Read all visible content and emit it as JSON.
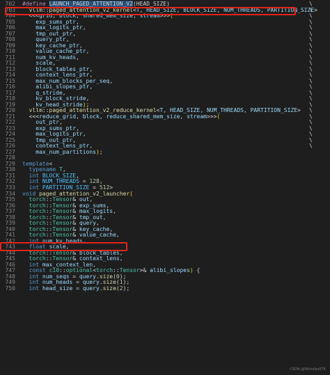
{
  "colors": {
    "background": "#1e1e1e",
    "line_number": "#858585",
    "highlight_box": "#e2251c",
    "selection": "#264f78"
  },
  "watermark": "CSDN @Nicholas07K",
  "continuation_char": "\\",
  "lines": [
    {
      "n": "702",
      "cont": true,
      "tokens": [
        [
          "macro",
          "#define "
        ],
        [
          "hl",
          "LAUNCH_PAGED_ATTENTION_V2"
        ],
        [
          "punc",
          "(HEAD_SIZE)"
        ]
      ]
    },
    {
      "n": "703",
      "cont": true,
      "tokens": [
        [
          "punc",
          "  "
        ],
        [
          "func",
          "vllm"
        ],
        [
          "punc",
          "::"
        ],
        [
          "func",
          "paged_attention_v2_kernel"
        ],
        [
          "punc",
          "<"
        ],
        [
          "var",
          "T"
        ],
        [
          "punc",
          ", "
        ],
        [
          "var",
          "HEAD_SIZE"
        ],
        [
          "punc",
          ", "
        ],
        [
          "var",
          "BLOCK_SIZE"
        ],
        [
          "punc",
          ", "
        ],
        [
          "var",
          "NUM_THREADS"
        ],
        [
          "punc",
          ", "
        ],
        [
          "var",
          "PARTITION_SIZE"
        ],
        [
          "punc",
          ">"
        ]
      ]
    },
    {
      "n": "704",
      "cont": true,
      "tokens": [
        [
          "punc",
          "  <<<"
        ],
        [
          "var",
          "grid"
        ],
        [
          "punc",
          ", "
        ],
        [
          "var",
          "block"
        ],
        [
          "punc",
          ", "
        ],
        [
          "var",
          "shared_mem_size"
        ],
        [
          "punc",
          ", "
        ],
        [
          "var",
          "stream"
        ],
        [
          "punc",
          ">>>"
        ],
        [
          "brace",
          "("
        ]
      ]
    },
    {
      "n": "705",
      "cont": true,
      "tokens": [
        [
          "punc",
          "    "
        ],
        [
          "var",
          "exp_sums_ptr"
        ],
        [
          "punc",
          ","
        ]
      ]
    },
    {
      "n": "706",
      "cont": true,
      "tokens": [
        [
          "punc",
          "    "
        ],
        [
          "var",
          "max_logits_ptr"
        ],
        [
          "punc",
          ","
        ]
      ]
    },
    {
      "n": "707",
      "cont": true,
      "tokens": [
        [
          "punc",
          "    "
        ],
        [
          "var",
          "tmp_out_ptr"
        ],
        [
          "punc",
          ","
        ]
      ]
    },
    {
      "n": "708",
      "cont": true,
      "tokens": [
        [
          "punc",
          "    "
        ],
        [
          "var",
          "query_ptr"
        ],
        [
          "punc",
          ","
        ]
      ]
    },
    {
      "n": "709",
      "cont": true,
      "tokens": [
        [
          "punc",
          "    "
        ],
        [
          "var",
          "key_cache_ptr"
        ],
        [
          "punc",
          ","
        ]
      ]
    },
    {
      "n": "710",
      "cont": true,
      "tokens": [
        [
          "punc",
          "    "
        ],
        [
          "var",
          "value_cache_ptr"
        ],
        [
          "punc",
          ","
        ]
      ]
    },
    {
      "n": "711",
      "cont": true,
      "tokens": [
        [
          "punc",
          "    "
        ],
        [
          "var",
          "num_kv_heads"
        ],
        [
          "punc",
          ","
        ]
      ]
    },
    {
      "n": "712",
      "cont": true,
      "tokens": [
        [
          "punc",
          "    "
        ],
        [
          "var",
          "scale"
        ],
        [
          "punc",
          ","
        ]
      ]
    },
    {
      "n": "713",
      "cont": true,
      "tokens": [
        [
          "punc",
          "    "
        ],
        [
          "var",
          "block_tables_ptr"
        ],
        [
          "punc",
          ","
        ]
      ]
    },
    {
      "n": "714",
      "cont": true,
      "tokens": [
        [
          "punc",
          "    "
        ],
        [
          "var",
          "context_lens_ptr"
        ],
        [
          "punc",
          ","
        ]
      ]
    },
    {
      "n": "715",
      "cont": true,
      "tokens": [
        [
          "punc",
          "    "
        ],
        [
          "var",
          "max_num_blocks_per_seq"
        ],
        [
          "punc",
          ","
        ]
      ]
    },
    {
      "n": "716",
      "cont": true,
      "tokens": [
        [
          "punc",
          "    "
        ],
        [
          "var",
          "alibi_slopes_ptr"
        ],
        [
          "punc",
          ","
        ]
      ]
    },
    {
      "n": "717",
      "cont": true,
      "tokens": [
        [
          "punc",
          "    "
        ],
        [
          "var",
          "q_stride"
        ],
        [
          "punc",
          ","
        ]
      ]
    },
    {
      "n": "718",
      "cont": true,
      "tokens": [
        [
          "punc",
          "    "
        ],
        [
          "var",
          "kv_block_stride"
        ],
        [
          "punc",
          ","
        ]
      ]
    },
    {
      "n": "719",
      "cont": true,
      "tokens": [
        [
          "punc",
          "    "
        ],
        [
          "var",
          "kv_head_stride"
        ],
        [
          "brace",
          ")"
        ],
        [
          "punc",
          ";"
        ]
      ]
    },
    {
      "n": "720",
      "cont": true,
      "tokens": [
        [
          "punc",
          "  "
        ],
        [
          "func",
          "vllm"
        ],
        [
          "punc",
          "::"
        ],
        [
          "func",
          "paged_attention_v2_reduce_kernel"
        ],
        [
          "punc",
          "<"
        ],
        [
          "var",
          "T"
        ],
        [
          "punc",
          ", "
        ],
        [
          "var",
          "HEAD_SIZE"
        ],
        [
          "punc",
          ", "
        ],
        [
          "var",
          "NUM_THREADS"
        ],
        [
          "punc",
          ", "
        ],
        [
          "var",
          "PARTITION_SIZE"
        ],
        [
          "punc",
          ">"
        ]
      ]
    },
    {
      "n": "721",
      "cont": true,
      "tokens": [
        [
          "punc",
          "  <<<"
        ],
        [
          "var",
          "reduce_grid"
        ],
        [
          "punc",
          ", "
        ],
        [
          "var",
          "block"
        ],
        [
          "punc",
          ", "
        ],
        [
          "var",
          "reduce_shared_mem_size"
        ],
        [
          "punc",
          ", "
        ],
        [
          "var",
          "stream"
        ],
        [
          "punc",
          ">>>"
        ],
        [
          "brace",
          "("
        ]
      ]
    },
    {
      "n": "722",
      "cont": true,
      "tokens": [
        [
          "punc",
          "    "
        ],
        [
          "var",
          "out_ptr"
        ],
        [
          "punc",
          ","
        ]
      ]
    },
    {
      "n": "723",
      "cont": true,
      "tokens": [
        [
          "punc",
          "    "
        ],
        [
          "var",
          "exp_sums_ptr"
        ],
        [
          "punc",
          ","
        ]
      ]
    },
    {
      "n": "724",
      "cont": true,
      "tokens": [
        [
          "punc",
          "    "
        ],
        [
          "var",
          "max_logits_ptr"
        ],
        [
          "punc",
          ","
        ]
      ]
    },
    {
      "n": "725",
      "cont": true,
      "tokens": [
        [
          "punc",
          "    "
        ],
        [
          "var",
          "tmp_out_ptr"
        ],
        [
          "punc",
          ","
        ]
      ]
    },
    {
      "n": "726",
      "cont": true,
      "tokens": [
        [
          "punc",
          "    "
        ],
        [
          "var",
          "context_lens_ptr"
        ],
        [
          "punc",
          ","
        ]
      ]
    },
    {
      "n": "727",
      "cont": false,
      "tokens": [
        [
          "punc",
          "    "
        ],
        [
          "var",
          "max_num_partitions"
        ],
        [
          "brace",
          ")"
        ],
        [
          "punc",
          ";"
        ]
      ]
    },
    {
      "n": "728",
      "cont": false,
      "tokens": []
    },
    {
      "n": "729",
      "cont": false,
      "tokens": [
        [
          "kw",
          "template"
        ],
        [
          "punc",
          "<"
        ]
      ]
    },
    {
      "n": "730",
      "cont": false,
      "tokens": [
        [
          "punc",
          "  "
        ],
        [
          "kw",
          "typename"
        ],
        [
          "punc",
          " "
        ],
        [
          "type",
          "T"
        ],
        [
          "punc",
          ","
        ]
      ]
    },
    {
      "n": "731",
      "cont": false,
      "tokens": [
        [
          "punc",
          "  "
        ],
        [
          "kw",
          "int"
        ],
        [
          "punc",
          " "
        ],
        [
          "const",
          "BLOCK_SIZE"
        ],
        [
          "punc",
          ","
        ]
      ]
    },
    {
      "n": "732",
      "cont": false,
      "tokens": [
        [
          "punc",
          "  "
        ],
        [
          "kw",
          "int"
        ],
        [
          "punc",
          " "
        ],
        [
          "const",
          "NUM_THREADS"
        ],
        [
          "punc",
          " = "
        ],
        [
          "num",
          "128"
        ],
        [
          "punc",
          ","
        ]
      ]
    },
    {
      "n": "733",
      "cont": false,
      "tokens": [
        [
          "punc",
          "  "
        ],
        [
          "kw",
          "int"
        ],
        [
          "punc",
          " "
        ],
        [
          "const",
          "PARTITION_SIZE"
        ],
        [
          "punc",
          " = "
        ],
        [
          "num",
          "512"
        ],
        [
          "punc",
          ">"
        ]
      ]
    },
    {
      "n": "734",
      "cont": false,
      "tokens": [
        [
          "kw",
          "void"
        ],
        [
          "punc",
          " "
        ],
        [
          "func",
          "paged_attention_v2_launcher"
        ],
        [
          "brace",
          "("
        ]
      ]
    },
    {
      "n": "735",
      "cont": false,
      "tokens": [
        [
          "punc",
          "  "
        ],
        [
          "type",
          "torch"
        ],
        [
          "punc",
          "::"
        ],
        [
          "type",
          "Tensor"
        ],
        [
          "punc",
          "& "
        ],
        [
          "var",
          "out"
        ],
        [
          "punc",
          ","
        ]
      ]
    },
    {
      "n": "736",
      "cont": false,
      "tokens": [
        [
          "punc",
          "  "
        ],
        [
          "type",
          "torch"
        ],
        [
          "punc",
          "::"
        ],
        [
          "type",
          "Tensor"
        ],
        [
          "punc",
          "& "
        ],
        [
          "var",
          "exp_sums"
        ],
        [
          "punc",
          ","
        ]
      ]
    },
    {
      "n": "737",
      "cont": false,
      "tokens": [
        [
          "punc",
          "  "
        ],
        [
          "type",
          "torch"
        ],
        [
          "punc",
          "::"
        ],
        [
          "type",
          "Tensor"
        ],
        [
          "punc",
          "& "
        ],
        [
          "var",
          "max_logits"
        ],
        [
          "punc",
          ","
        ]
      ]
    },
    {
      "n": "738",
      "cont": false,
      "tokens": [
        [
          "punc",
          "  "
        ],
        [
          "type",
          "torch"
        ],
        [
          "punc",
          "::"
        ],
        [
          "type",
          "Tensor"
        ],
        [
          "punc",
          "& "
        ],
        [
          "var",
          "tmp_out"
        ],
        [
          "punc",
          ","
        ]
      ]
    },
    {
      "n": "739",
      "cont": false,
      "tokens": [
        [
          "punc",
          "  "
        ],
        [
          "type",
          "torch"
        ],
        [
          "punc",
          "::"
        ],
        [
          "type",
          "Tensor"
        ],
        [
          "punc",
          "& "
        ],
        [
          "var",
          "query"
        ],
        [
          "punc",
          ","
        ]
      ]
    },
    {
      "n": "740",
      "cont": false,
      "tokens": [
        [
          "punc",
          "  "
        ],
        [
          "type",
          "torch"
        ],
        [
          "punc",
          "::"
        ],
        [
          "type",
          "Tensor"
        ],
        [
          "punc",
          "& "
        ],
        [
          "var",
          "key_cache"
        ],
        [
          "punc",
          ","
        ]
      ]
    },
    {
      "n": "741",
      "cont": false,
      "tokens": [
        [
          "punc",
          "  "
        ],
        [
          "type",
          "torch"
        ],
        [
          "punc",
          "::"
        ],
        [
          "type",
          "Tensor"
        ],
        [
          "punc",
          "& "
        ],
        [
          "var",
          "value_cache"
        ],
        [
          "punc",
          ","
        ]
      ]
    },
    {
      "n": "742",
      "cont": false,
      "tokens": [
        [
          "punc",
          "  "
        ],
        [
          "kw",
          "int"
        ],
        [
          "punc",
          " "
        ],
        [
          "var",
          "num_kv_heads"
        ],
        [
          "punc",
          ","
        ]
      ]
    },
    {
      "n": "743",
      "cont": false,
      "tokens": [
        [
          "punc",
          "  "
        ],
        [
          "kw",
          "float"
        ],
        [
          "punc",
          " "
        ],
        [
          "var",
          "scale"
        ],
        [
          "punc",
          ","
        ]
      ]
    },
    {
      "n": "744",
      "cont": false,
      "tokens": [
        [
          "punc",
          "  "
        ],
        [
          "type",
          "torch"
        ],
        [
          "punc",
          "::"
        ],
        [
          "type",
          "Tensor"
        ],
        [
          "punc",
          "& "
        ],
        [
          "var",
          "block_tables"
        ],
        [
          "punc",
          ","
        ]
      ]
    },
    {
      "n": "745",
      "cont": false,
      "tokens": [
        [
          "punc",
          "  "
        ],
        [
          "type",
          "torch"
        ],
        [
          "punc",
          "::"
        ],
        [
          "type",
          "Tensor"
        ],
        [
          "punc",
          "& "
        ],
        [
          "var",
          "context_lens"
        ],
        [
          "punc",
          ","
        ]
      ]
    },
    {
      "n": "746",
      "cont": false,
      "tokens": [
        [
          "punc",
          "  "
        ],
        [
          "kw",
          "int"
        ],
        [
          "punc",
          " "
        ],
        [
          "var",
          "max_context_len"
        ],
        [
          "punc",
          ","
        ]
      ]
    },
    {
      "n": "747",
      "cont": false,
      "tokens": [
        [
          "punc",
          "  "
        ],
        [
          "kw",
          "const"
        ],
        [
          "punc",
          " "
        ],
        [
          "type",
          "c10"
        ],
        [
          "punc",
          "::"
        ],
        [
          "type",
          "optional"
        ],
        [
          "punc",
          "<"
        ],
        [
          "type",
          "torch"
        ],
        [
          "punc",
          "::"
        ],
        [
          "type",
          "Tensor"
        ],
        [
          "punc",
          ">& "
        ],
        [
          "var",
          "alibi_slopes"
        ],
        [
          "brace",
          ")"
        ],
        [
          "punc",
          " {"
        ]
      ]
    },
    {
      "n": "748",
      "cont": false,
      "tokens": [
        [
          "punc",
          "  "
        ],
        [
          "kw",
          "int"
        ],
        [
          "punc",
          " "
        ],
        [
          "var",
          "num_seqs"
        ],
        [
          "punc",
          " = "
        ],
        [
          "var",
          "query"
        ],
        [
          "punc",
          "."
        ],
        [
          "func",
          "size"
        ],
        [
          "punc",
          "("
        ],
        [
          "num",
          "0"
        ],
        [
          "punc",
          ");"
        ]
      ]
    },
    {
      "n": "749",
      "cont": false,
      "tokens": [
        [
          "punc",
          "  "
        ],
        [
          "kw",
          "int"
        ],
        [
          "punc",
          " "
        ],
        [
          "var",
          "num_heads"
        ],
        [
          "punc",
          " = "
        ],
        [
          "var",
          "query"
        ],
        [
          "punc",
          "."
        ],
        [
          "func",
          "size"
        ],
        [
          "punc",
          "("
        ],
        [
          "num",
          "1"
        ],
        [
          "punc",
          ");"
        ]
      ]
    },
    {
      "n": "750",
      "cont": false,
      "tokens": [
        [
          "punc",
          "  "
        ],
        [
          "kw",
          "int"
        ],
        [
          "punc",
          " "
        ],
        [
          "var",
          "head_size"
        ],
        [
          "punc",
          " = "
        ],
        [
          "var",
          "query"
        ],
        [
          "punc",
          "."
        ],
        [
          "func",
          "size"
        ],
        [
          "punc",
          "("
        ],
        [
          "num",
          "2"
        ],
        [
          "punc",
          ");"
        ]
      ]
    }
  ]
}
